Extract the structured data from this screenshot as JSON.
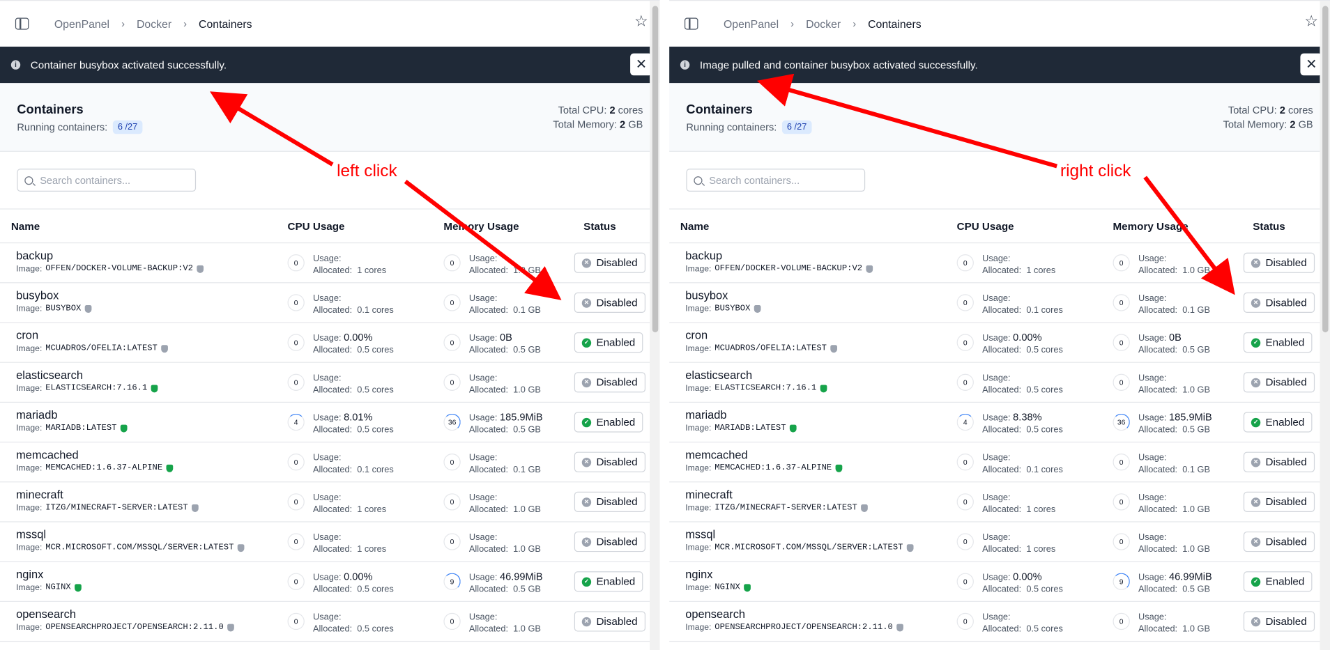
{
  "breadcrumb": [
    "OpenPanel",
    "Docker",
    "Containers"
  ],
  "page_title": "Containers",
  "running_label": "Running containers:",
  "running_count": "6 /27",
  "totals": {
    "cpu_label": "Total CPU:",
    "cpu_value": "2",
    "cpu_unit": "cores",
    "mem_label": "Total Memory:",
    "mem_value": "2",
    "mem_unit": "GB"
  },
  "search_placeholder": "Search containers...",
  "columns": [
    "Name",
    "CPU Usage",
    "Memory Usage",
    "Status"
  ],
  "image_label": "Image:",
  "usage_label": "Usage:",
  "allocated_label": "Allocated:",
  "panels": [
    {
      "alert": "Container busybox activated successfully.",
      "annotation": "left click",
      "rows": [
        {
          "name": "backup",
          "image": "OFFEN/DOCKER-VOLUME-BACKUP:V2",
          "verified": "gray",
          "cpu_pct": "0",
          "cpu_usage": "",
          "cpu_alloc": "1 cores",
          "mem_val": "0",
          "mem_usage": "",
          "mem_alloc": "1.0 GB",
          "status": "Disabled"
        },
        {
          "name": "busybox",
          "image": "BUSYBOX",
          "verified": "gray",
          "cpu_pct": "0",
          "cpu_usage": "",
          "cpu_alloc": "0.1 cores",
          "mem_val": "0",
          "mem_usage": "",
          "mem_alloc": "0.1 GB",
          "status": "Disabled"
        },
        {
          "name": "cron",
          "image": "MCUADROS/OFELIA:LATEST",
          "verified": "gray",
          "cpu_pct": "0",
          "cpu_usage": "0.00%",
          "cpu_alloc": "0.5 cores",
          "mem_val": "0",
          "mem_usage": "0B",
          "mem_alloc": "0.5 GB",
          "status": "Enabled"
        },
        {
          "name": "elasticsearch",
          "image": "ELASTICSEARCH:7.16.1",
          "verified": "green",
          "cpu_pct": "0",
          "cpu_usage": "",
          "cpu_alloc": "0.5 cores",
          "mem_val": "0",
          "mem_usage": "",
          "mem_alloc": "1.0 GB",
          "status": "Disabled"
        },
        {
          "name": "mariadb",
          "image": "MARIADB:LATEST",
          "verified": "green",
          "cpu_pct": "4",
          "cpu_usage": "8.01%",
          "cpu_alloc": "0.5 cores",
          "mem_val": "36",
          "mem_usage": "185.9MiB",
          "mem_alloc": "0.5 GB",
          "status": "Enabled"
        },
        {
          "name": "memcached",
          "image": "MEMCACHED:1.6.37-ALPINE",
          "verified": "green",
          "cpu_pct": "0",
          "cpu_usage": "",
          "cpu_alloc": "0.1 cores",
          "mem_val": "0",
          "mem_usage": "",
          "mem_alloc": "0.1 GB",
          "status": "Disabled"
        },
        {
          "name": "minecraft",
          "image": "ITZG/MINECRAFT-SERVER:LATEST",
          "verified": "gray",
          "cpu_pct": "0",
          "cpu_usage": "",
          "cpu_alloc": "1 cores",
          "mem_val": "0",
          "mem_usage": "",
          "mem_alloc": "1.0 GB",
          "status": "Disabled"
        },
        {
          "name": "mssql",
          "image": "MCR.MICROSOFT.COM/MSSQL/SERVER:LATEST",
          "verified": "gray",
          "cpu_pct": "0",
          "cpu_usage": "",
          "cpu_alloc": "1 cores",
          "mem_val": "0",
          "mem_usage": "",
          "mem_alloc": "1.0 GB",
          "status": "Disabled"
        },
        {
          "name": "nginx",
          "image": "NGINX",
          "verified": "green",
          "cpu_pct": "0",
          "cpu_usage": "0.00%",
          "cpu_alloc": "0.5 cores",
          "mem_val": "9",
          "mem_usage": "46.99MiB",
          "mem_alloc": "0.5 GB",
          "status": "Enabled"
        },
        {
          "name": "opensearch",
          "image": "OPENSEARCHPROJECT/OPENSEARCH:2.11.0",
          "verified": "gray",
          "cpu_pct": "0",
          "cpu_usage": "",
          "cpu_alloc": "0.5 cores",
          "mem_val": "0",
          "mem_usage": "",
          "mem_alloc": "1.0 GB",
          "status": "Disabled"
        }
      ]
    },
    {
      "alert": "Image pulled and container busybox activated successfully.",
      "annotation": "right click",
      "rows": [
        {
          "name": "backup",
          "image": "OFFEN/DOCKER-VOLUME-BACKUP:V2",
          "verified": "gray",
          "cpu_pct": "0",
          "cpu_usage": "",
          "cpu_alloc": "1 cores",
          "mem_val": "0",
          "mem_usage": "",
          "mem_alloc": "1.0 GB",
          "status": "Disabled"
        },
        {
          "name": "busybox",
          "image": "BUSYBOX",
          "verified": "gray",
          "cpu_pct": "0",
          "cpu_usage": "",
          "cpu_alloc": "0.1 cores",
          "mem_val": "0",
          "mem_usage": "",
          "mem_alloc": "0.1 GB",
          "status": "Disabled"
        },
        {
          "name": "cron",
          "image": "MCUADROS/OFELIA:LATEST",
          "verified": "gray",
          "cpu_pct": "0",
          "cpu_usage": "0.00%",
          "cpu_alloc": "0.5 cores",
          "mem_val": "0",
          "mem_usage": "0B",
          "mem_alloc": "0.5 GB",
          "status": "Enabled"
        },
        {
          "name": "elasticsearch",
          "image": "ELASTICSEARCH:7.16.1",
          "verified": "green",
          "cpu_pct": "0",
          "cpu_usage": "",
          "cpu_alloc": "0.5 cores",
          "mem_val": "0",
          "mem_usage": "",
          "mem_alloc": "1.0 GB",
          "status": "Disabled"
        },
        {
          "name": "mariadb",
          "image": "MARIADB:LATEST",
          "verified": "green",
          "cpu_pct": "4",
          "cpu_usage": "8.38%",
          "cpu_alloc": "0.5 cores",
          "mem_val": "36",
          "mem_usage": "185.9MiB",
          "mem_alloc": "0.5 GB",
          "status": "Enabled"
        },
        {
          "name": "memcached",
          "image": "MEMCACHED:1.6.37-ALPINE",
          "verified": "green",
          "cpu_pct": "0",
          "cpu_usage": "",
          "cpu_alloc": "0.1 cores",
          "mem_val": "0",
          "mem_usage": "",
          "mem_alloc": "0.1 GB",
          "status": "Disabled"
        },
        {
          "name": "minecraft",
          "image": "ITZG/MINECRAFT-SERVER:LATEST",
          "verified": "gray",
          "cpu_pct": "0",
          "cpu_usage": "",
          "cpu_alloc": "1 cores",
          "mem_val": "0",
          "mem_usage": "",
          "mem_alloc": "1.0 GB",
          "status": "Disabled"
        },
        {
          "name": "mssql",
          "image": "MCR.MICROSOFT.COM/MSSQL/SERVER:LATEST",
          "verified": "gray",
          "cpu_pct": "0",
          "cpu_usage": "",
          "cpu_alloc": "1 cores",
          "mem_val": "0",
          "mem_usage": "",
          "mem_alloc": "1.0 GB",
          "status": "Disabled"
        },
        {
          "name": "nginx",
          "image": "NGINX",
          "verified": "green",
          "cpu_pct": "0",
          "cpu_usage": "0.00%",
          "cpu_alloc": "0.5 cores",
          "mem_val": "9",
          "mem_usage": "46.99MiB",
          "mem_alloc": "0.5 GB",
          "status": "Enabled"
        },
        {
          "name": "opensearch",
          "image": "OPENSEARCHPROJECT/OPENSEARCH:2.11.0",
          "verified": "gray",
          "cpu_pct": "0",
          "cpu_usage": "",
          "cpu_alloc": "0.5 cores",
          "mem_val": "0",
          "mem_usage": "",
          "mem_alloc": "1.0 GB",
          "status": "Disabled"
        }
      ]
    }
  ],
  "colors": {
    "alert_bg": "#1f2937",
    "enabled": "#16a34a",
    "disabled": "#9ca3af",
    "annotation": "#ff0000",
    "badge_bg": "#dbeafe"
  },
  "icons": [
    "sidebar-toggle-icon",
    "chevron-right-icon",
    "star-icon",
    "info-icon",
    "close-icon",
    "search-icon",
    "shield-check-icon",
    "check-circle-icon",
    "x-circle-icon"
  ]
}
